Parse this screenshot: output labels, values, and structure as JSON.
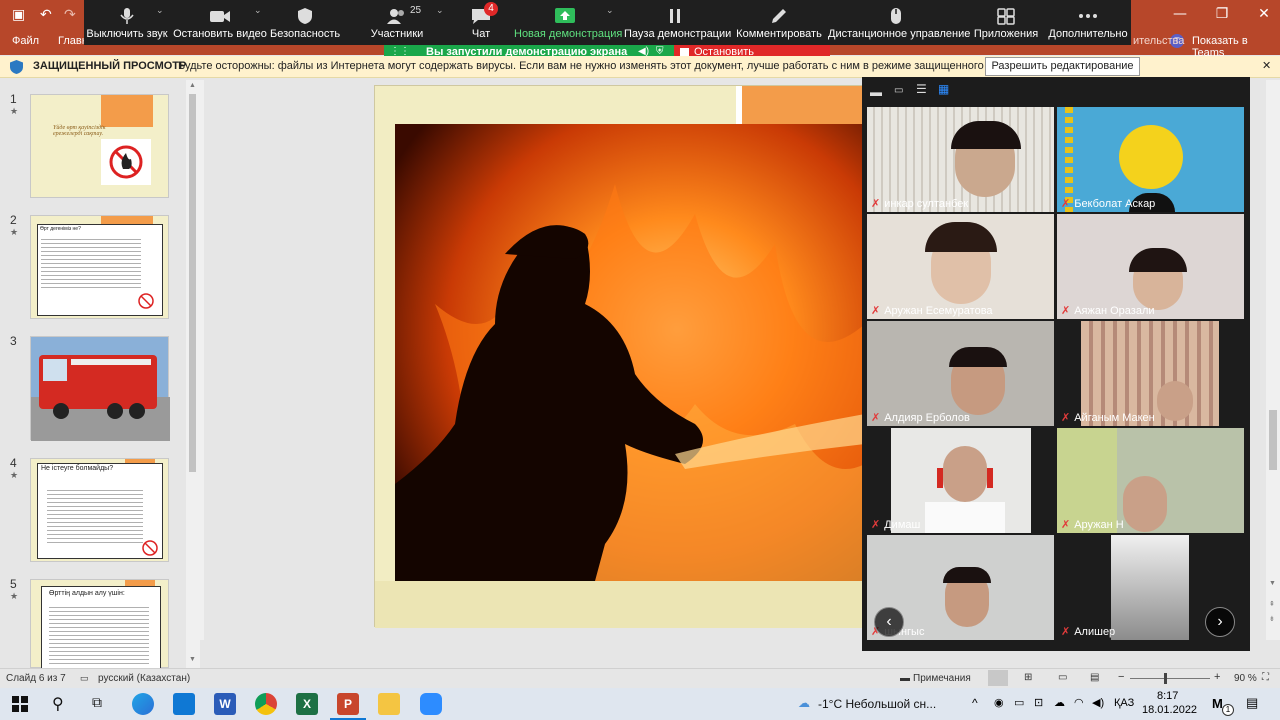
{
  "powerpoint": {
    "menu": {
      "file": "Файл",
      "home_partial": "Главн",
      "show_in_teams": "Показать в Teams",
      "teams_badge": "Т"
    },
    "window": {
      "minimize": "—",
      "restore": "❐",
      "close": "✕"
    }
  },
  "zoom_toolbar": {
    "mute": "Выключить звук",
    "video": "Остановить видео",
    "security": "Безопасность",
    "participants": "Участники",
    "participants_count": "25",
    "chat": "Чат",
    "chat_badge": "4",
    "new_share": "Новая демонстрация",
    "pause_share": "Пауза демонстрации",
    "annotate": "Комментировать",
    "remote_control": "Дистанционное управление",
    "apps": "Приложения",
    "more": "Дополнительно",
    "partial_right": "ительства"
  },
  "share_banner": {
    "text": "Вы запустили демонстрацию экрана",
    "stop": "Остановить демонстрацию"
  },
  "protected_view": {
    "title": "ЗАЩИЩЕННЫЙ ПРОСМОТР",
    "message": "Будьте осторожны: файлы из Интернета могут содержать вирусы. Если вам не нужно изменять этот документ, лучше работать с ним в режиме защищенного просмотра.",
    "enable_button": "Разрешить редактирование",
    "close": "✕"
  },
  "thumbnails": [
    {
      "num": "1",
      "star": "★",
      "title": "Үйде өрт қауіпсіздік ережелерді сақтау."
    },
    {
      "num": "2",
      "star": "★",
      "title": "Өрт дегеніміз не?"
    },
    {
      "num": "3",
      "star": ""
    },
    {
      "num": "4",
      "star": "★",
      "title": "Не істеуге болмайды?"
    },
    {
      "num": "5",
      "star": "★",
      "title": "Өрттің алдын алу үшін:"
    }
  ],
  "gallery": {
    "participants": [
      {
        "name": "инкар султанбек",
        "bg": "#d8d4cc"
      },
      {
        "name": "Бекболат Аскар",
        "bg": "#4aa9d6"
      },
      {
        "name": "Аружан Есемуратова",
        "bg": "#e6e0d8"
      },
      {
        "name": "Аяжан Оразали",
        "bg": "#ddd6d4"
      },
      {
        "name": "Алдияр Ерболов",
        "bg": "#b9b6b0"
      },
      {
        "name": "Айганым Макен",
        "bg": "#c9b9a8"
      },
      {
        "name": "Димаш",
        "bg": "#e8e8e6"
      },
      {
        "name": "Аружан Н",
        "bg": "#b9c2a9"
      },
      {
        "name": "шынгыс",
        "bg": "#cfd0cf"
      },
      {
        "name": "Алишер",
        "bg": "#9d9d9d"
      }
    ]
  },
  "statusbar": {
    "slide_info": "Слайд 6 из 7",
    "language": "русский (Казахстан)",
    "notes": "Примечания",
    "zoom_level": "90 %"
  },
  "taskbar": {
    "weather": "-1°C  Небольшой сн...",
    "lang": "ҚАЗ",
    "time": "8:17",
    "date": "18.01.2022",
    "notify_count": "1"
  },
  "colors": {
    "ppt_accent": "#b7472a",
    "zoom_bar": "#1f1f1f",
    "share_green": "#1aa74a",
    "stop_red": "#e02828",
    "slide_orange": "#f39c4a"
  }
}
